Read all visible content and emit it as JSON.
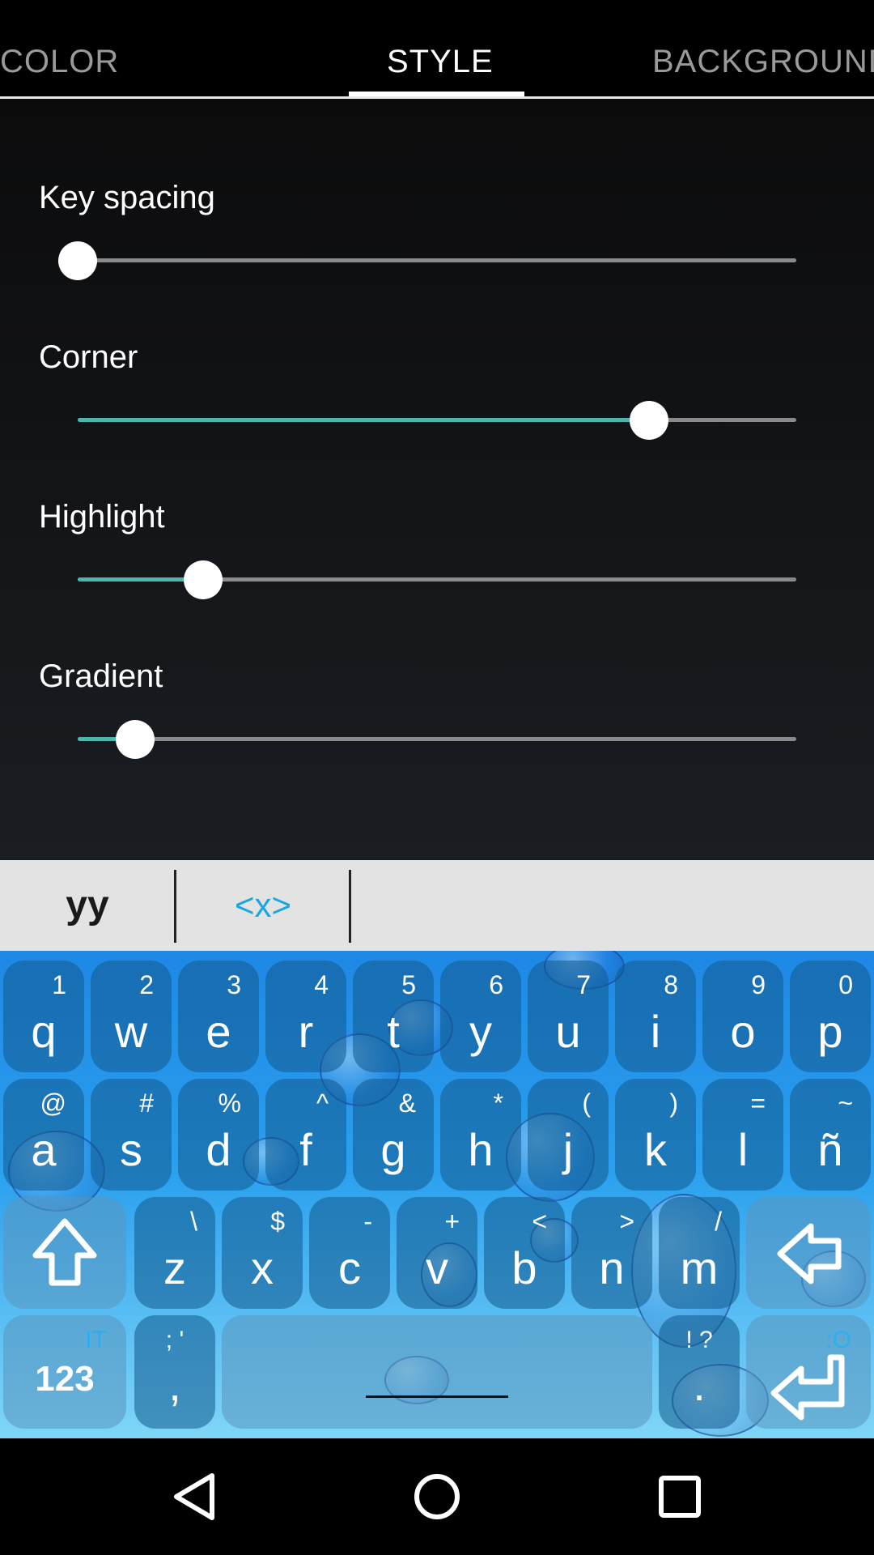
{
  "tabs": [
    {
      "label": "COLOR"
    },
    {
      "label": "STYLE"
    },
    {
      "label": "BACKGROUND"
    }
  ],
  "settings": [
    {
      "label": "Key spacing",
      "value_percent": 0
    },
    {
      "label": "Corner",
      "value_percent": 79.5
    },
    {
      "label": "Highlight",
      "value_percent": 17.5
    },
    {
      "label": "Gradient",
      "value_percent": 8
    }
  ],
  "suggestions": [
    "yy",
    "<x>"
  ],
  "keyboard": {
    "row1": [
      {
        "main": "q",
        "hint": "1"
      },
      {
        "main": "w",
        "hint": "2"
      },
      {
        "main": "e",
        "hint": "3"
      },
      {
        "main": "r",
        "hint": "4"
      },
      {
        "main": "t",
        "hint": "5"
      },
      {
        "main": "y",
        "hint": "6"
      },
      {
        "main": "u",
        "hint": "7"
      },
      {
        "main": "i",
        "hint": "8"
      },
      {
        "main": "o",
        "hint": "9"
      },
      {
        "main": "p",
        "hint": "0"
      }
    ],
    "row2": [
      {
        "main": "a",
        "hint": "@"
      },
      {
        "main": "s",
        "hint": "#"
      },
      {
        "main": "d",
        "hint": "%"
      },
      {
        "main": "f",
        "hint": "^"
      },
      {
        "main": "g",
        "hint": "&"
      },
      {
        "main": "h",
        "hint": "*"
      },
      {
        "main": "j",
        "hint": "("
      },
      {
        "main": "k",
        "hint": ")"
      },
      {
        "main": "l",
        "hint": "="
      },
      {
        "main": "ñ",
        "hint": "~"
      }
    ],
    "row3": [
      {
        "main": "z",
        "hint": "\\"
      },
      {
        "main": "x",
        "hint": "$"
      },
      {
        "main": "c",
        "hint": "-"
      },
      {
        "main": "v",
        "hint": "+"
      },
      {
        "main": "b",
        "hint": "<"
      },
      {
        "main": "n",
        "hint": ">"
      },
      {
        "main": "m",
        "hint": "/"
      }
    ],
    "numbers_key": {
      "main": "123",
      "hint": "IT"
    },
    "comma_key": {
      "main": ",",
      "hint": "; '"
    },
    "period_key": {
      "main": ".",
      "hint": "! ?"
    },
    "enter_key": {
      "hint": ":O"
    },
    "icons": {
      "shift": "shift-arrow-icon",
      "backspace": "backspace-arrow-icon",
      "enter": "enter-arrow-icon"
    }
  },
  "navbar": {
    "icons": [
      "back-triangle-icon",
      "home-circle-icon",
      "recents-square-icon"
    ]
  },
  "colors": {
    "accent": "#4db6ac",
    "suggestion_blue": "#1aa7e0",
    "keyboard_blue": "#1e88e5"
  }
}
